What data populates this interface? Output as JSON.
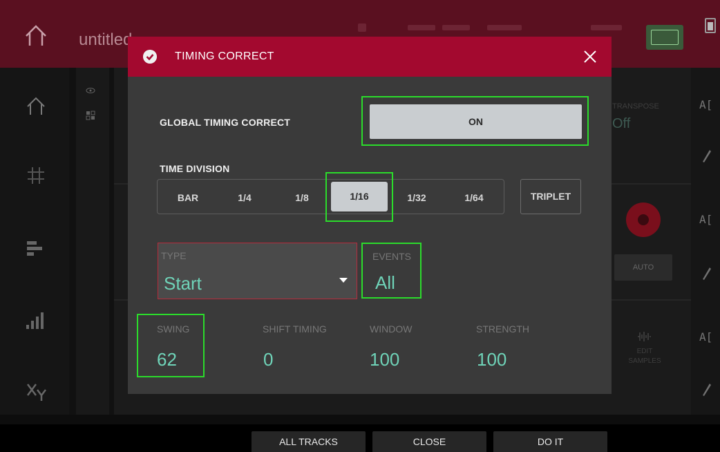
{
  "background": {
    "project_small_label": "",
    "project_name": "untitled",
    "right_column": [
      "A[",
      "A[",
      "A["
    ],
    "transpose_value": "Off",
    "auto_label": "AUTO",
    "edit_samples_label": [
      "EDIT",
      "SAMPLES"
    ]
  },
  "dialog": {
    "title": "TIMING CORRECT",
    "global_label": "GLOBAL TIMING CORRECT",
    "global_value": "ON",
    "time_division_label": "TIME DIVISION",
    "divisions": [
      "BAR",
      "1/4",
      "1/8",
      "1/16",
      "1/32",
      "1/64"
    ],
    "selected_division": "1/16",
    "triplet_label": "TRIPLET",
    "type": {
      "label": "TYPE",
      "value": "Start"
    },
    "events": {
      "label": "EVENTS",
      "value": "All"
    },
    "swing": {
      "label": "SWING",
      "value": "62"
    },
    "shift_timing": {
      "label": "SHIFT TIMING",
      "value": "0"
    },
    "window": {
      "label": "WINDOW",
      "value": "100"
    },
    "strength": {
      "label": "STRENGTH",
      "value": "100"
    }
  },
  "bottom": {
    "all_tracks": "ALL TRACKS",
    "close": "CLOSE",
    "do_it": "DO IT"
  },
  "colors": {
    "header": "#a3092f",
    "accent_value": "#6fd3b8",
    "highlight": "#2bdc2b",
    "button_light": "#c9cdd0"
  },
  "icons": [
    "home-icon",
    "check-circle-icon",
    "close-icon",
    "grid-icon",
    "eye-icon",
    "bars-icon",
    "levels-icon",
    "xy-icon",
    "pencil-icon",
    "record-icon",
    "battery-icon"
  ]
}
